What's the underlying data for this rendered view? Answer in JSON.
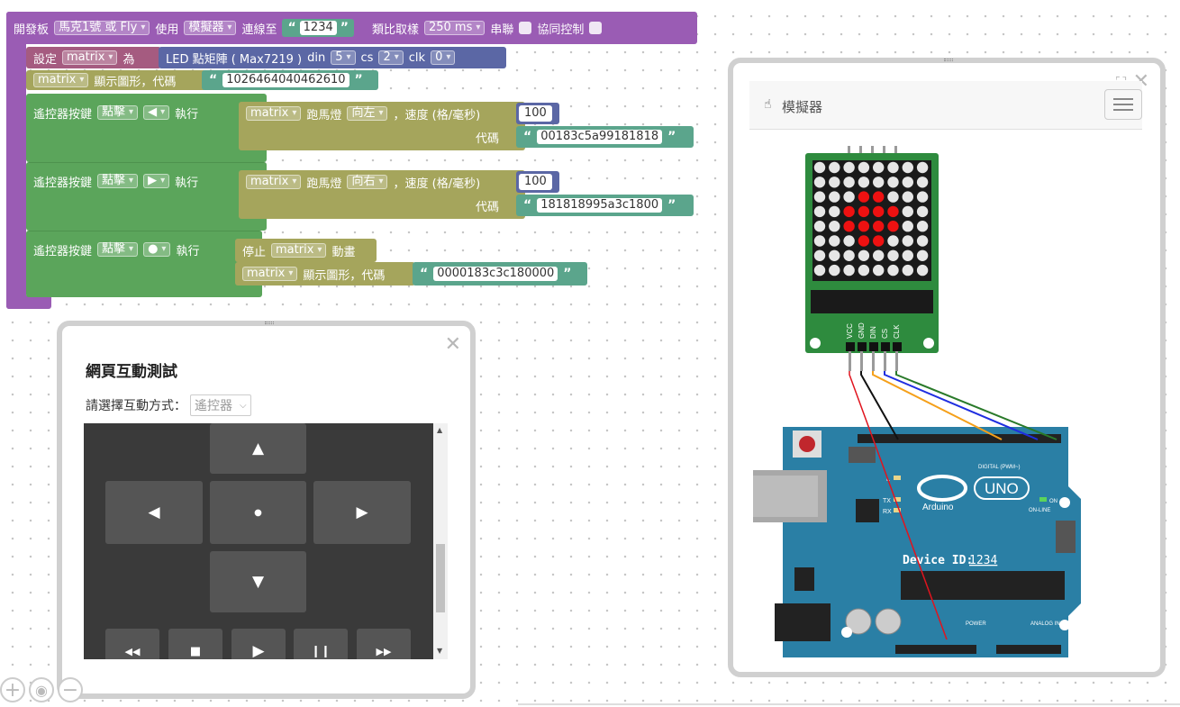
{
  "blocks": {
    "top": {
      "dev_label": "開發板",
      "board": "馬克1號 或 Fly",
      "use_label": "使用",
      "mode": "模擬器",
      "connect_label": "連線至",
      "device_id": "1234",
      "sample_label": "類比取樣",
      "sample_rate": "250 ms",
      "serial_label": "串聯",
      "coop_label": "協同控制"
    },
    "set": {
      "set_label": "設定",
      "var": "matrix",
      "as_label": "為",
      "led_label": "LED 點矩陣 ( Max7219 )",
      "din_label": "din",
      "din": "5",
      "cs_label": "cs",
      "cs": "2",
      "clk_label": "clk",
      "clk": "0"
    },
    "show": {
      "var": "matrix",
      "label": "顯示圖形，代碼",
      "code": "1026464040462610"
    },
    "remote": [
      {
        "label": "遙控器按鍵",
        "action": "點擊",
        "key": "◀",
        "exec": "執行",
        "var": "matrix",
        "marquee_label": "跑馬燈",
        "direction": "向左",
        "speed_label": "，速度 (格/毫秒)",
        "speed": "100",
        "code_label": "代碼",
        "code": "00183c5a99181818"
      },
      {
        "label": "遙控器按鍵",
        "action": "點擊",
        "key": "▶",
        "exec": "執行",
        "var": "matrix",
        "marquee_label": "跑馬燈",
        "direction": "向右",
        "speed_label": "，速度 (格/毫秒)",
        "speed": "100",
        "code_label": "代碼",
        "code": "181818995a3c1800"
      },
      {
        "label": "遙控器按鍵",
        "action": "點擊",
        "key": "●",
        "exec": "執行",
        "stop_label": "停止",
        "var": "matrix",
        "anim_label": "動畫",
        "show_label": "顯示圖形，代碼",
        "code": "0000183c3c180000"
      }
    ]
  },
  "web_panel": {
    "title": "網頁互動測試",
    "mode_label": "請選擇互動方式：",
    "mode_value": "遙控器",
    "close": "✕",
    "pad": {
      "up": "▲",
      "left": "◀",
      "center": "●",
      "right": "▶",
      "down": "▼",
      "rewind": "◀◀",
      "stop": "■",
      "play": "▶",
      "pause": "❙❙",
      "forward": "▶▶"
    }
  },
  "sim_panel": {
    "title": "模擬器",
    "close": "✕",
    "expand": "⛶",
    "menu_icon": "hamburger-icon",
    "pin_labels": [
      "VCC",
      "GND",
      "DIN",
      "CS",
      "CLK"
    ],
    "device_id_label": "Device ID:",
    "device_id": "1234",
    "arduino_text": "Arduino",
    "uno_text": "UNO",
    "digital_label": "DIGITAL (PWM~)",
    "power_label": "POWER",
    "analog_label": "ANALOG IN",
    "on_label": "ON",
    "online_label": "ON-LINE",
    "tx_label": "TX",
    "rx_label": "RX",
    "l_label": "L",
    "led_matrix_lit": [
      [
        2,
        3
      ],
      [
        2,
        4
      ],
      [
        3,
        2
      ],
      [
        3,
        3
      ],
      [
        3,
        4
      ],
      [
        3,
        5
      ],
      [
        4,
        2
      ],
      [
        4,
        3
      ],
      [
        4,
        4
      ],
      [
        4,
        5
      ],
      [
        5,
        3
      ],
      [
        5,
        4
      ]
    ]
  },
  "colors": {
    "purple": "#9a5cb4",
    "blue": "#5b67a5",
    "olive": "#a5a55c",
    "green": "#5ba55b",
    "teal": "#5ba58c",
    "board": "#2a7fa5",
    "pcb_green": "#2e8b3e",
    "led_on": "#ee1111"
  },
  "zoom": {
    "in": "+",
    "reset": "◉",
    "out": "−"
  }
}
